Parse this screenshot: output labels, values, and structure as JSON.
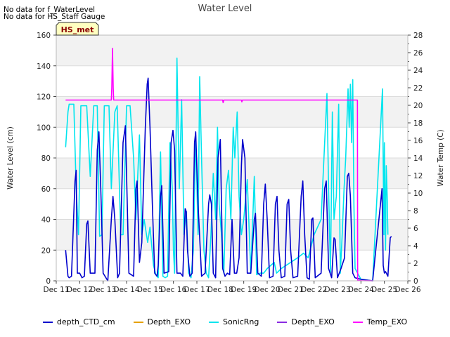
{
  "notes": [
    "No data for f_WaterLevel",
    "No data for HS_Staff Gauge"
  ],
  "site_badge": "HS_met",
  "chart_data": {
    "type": "line",
    "title": "Water Level",
    "xlabel": "",
    "ylabel": "Water Level (cm)",
    "y2label": "Water Temp (C)",
    "xlim": [
      11,
      26
    ],
    "ylim": [
      0,
      160
    ],
    "y2lim": [
      0,
      28
    ],
    "x_ticks": [
      {
        "v": 11,
        "label": "Dec 11"
      },
      {
        "v": 12,
        "label": "Dec 12"
      },
      {
        "v": 13,
        "label": "Dec 13"
      },
      {
        "v": 14,
        "label": "Dec 14"
      },
      {
        "v": 15,
        "label": "Dec 15"
      },
      {
        "v": 16,
        "label": "Dec 16"
      },
      {
        "v": 17,
        "label": "Dec 17"
      },
      {
        "v": 18,
        "label": "Dec 18"
      },
      {
        "v": 19,
        "label": "Dec 19"
      },
      {
        "v": 20,
        "label": "Dec 20"
      },
      {
        "v": 21,
        "label": "Dec 21"
      },
      {
        "v": 22,
        "label": "Dec 22"
      },
      {
        "v": 23,
        "label": "Dec 23"
      },
      {
        "v": 24,
        "label": "Dec 24"
      },
      {
        "v": 25,
        "label": "Dec 25"
      },
      {
        "v": 26,
        "label": "Dec 26"
      }
    ],
    "y_ticks": [
      0,
      20,
      40,
      60,
      80,
      100,
      120,
      140,
      160
    ],
    "y2_ticks": [
      0,
      2,
      4,
      6,
      8,
      10,
      12,
      14,
      16,
      18,
      20,
      22,
      24,
      26,
      28
    ],
    "legend_position": "bottom",
    "series": [
      {
        "name": "depth_CTD_cm",
        "color": "#0000cc",
        "axis": "left",
        "points": [
          [
            11.4,
            20
          ],
          [
            11.5,
            3
          ],
          [
            11.55,
            2
          ],
          [
            11.65,
            3
          ],
          [
            11.8,
            65
          ],
          [
            11.85,
            72
          ],
          [
            11.9,
            5
          ],
          [
            12.0,
            5
          ],
          [
            12.1,
            2
          ],
          [
            12.2,
            3
          ],
          [
            12.3,
            37
          ],
          [
            12.35,
            39
          ],
          [
            12.45,
            5
          ],
          [
            12.65,
            5
          ],
          [
            12.75,
            85
          ],
          [
            12.82,
            97
          ],
          [
            12.9,
            60
          ],
          [
            13.0,
            5
          ],
          [
            13.2,
            0
          ],
          [
            13.35,
            40
          ],
          [
            13.42,
            55
          ],
          [
            13.5,
            40
          ],
          [
            13.62,
            2
          ],
          [
            13.7,
            5
          ],
          [
            13.85,
            90
          ],
          [
            13.95,
            101
          ],
          [
            14.1,
            5
          ],
          [
            14.3,
            3
          ],
          [
            14.4,
            60
          ],
          [
            14.45,
            65
          ],
          [
            14.55,
            12
          ],
          [
            14.65,
            25
          ],
          [
            14.8,
            100
          ],
          [
            14.88,
            128
          ],
          [
            14.92,
            132
          ],
          [
            15.0,
            100
          ],
          [
            15.1,
            50
          ],
          [
            15.2,
            5
          ],
          [
            15.3,
            3
          ],
          [
            15.35,
            10
          ],
          [
            15.45,
            55
          ],
          [
            15.5,
            62
          ],
          [
            15.6,
            5
          ],
          [
            15.8,
            6
          ],
          [
            15.9,
            90
          ],
          [
            15.98,
            98
          ],
          [
            16.05,
            85
          ],
          [
            16.15,
            5
          ],
          [
            16.3,
            5
          ],
          [
            16.4,
            3
          ],
          [
            16.5,
            47
          ],
          [
            16.55,
            45
          ],
          [
            16.6,
            20
          ],
          [
            16.7,
            3
          ],
          [
            16.8,
            5
          ],
          [
            16.9,
            90
          ],
          [
            16.95,
            97
          ],
          [
            17.05,
            50
          ],
          [
            17.2,
            3
          ],
          [
            17.35,
            5
          ],
          [
            17.5,
            50
          ],
          [
            17.55,
            56
          ],
          [
            17.62,
            50
          ],
          [
            17.7,
            5
          ],
          [
            17.8,
            2
          ],
          [
            17.9,
            80
          ],
          [
            18.0,
            92
          ],
          [
            18.1,
            8
          ],
          [
            18.2,
            3
          ],
          [
            18.3,
            5
          ],
          [
            18.4,
            4
          ],
          [
            18.5,
            40
          ],
          [
            18.6,
            5
          ],
          [
            18.7,
            5
          ],
          [
            18.8,
            15
          ],
          [
            18.9,
            75
          ],
          [
            18.95,
            92
          ],
          [
            19.05,
            80
          ],
          [
            19.15,
            5
          ],
          [
            19.3,
            5
          ],
          [
            19.45,
            40
          ],
          [
            19.5,
            44
          ],
          [
            19.6,
            5
          ],
          [
            19.75,
            3
          ],
          [
            19.85,
            50
          ],
          [
            19.92,
            63
          ],
          [
            20.0,
            40
          ],
          [
            20.1,
            2
          ],
          [
            20.25,
            3
          ],
          [
            20.35,
            50
          ],
          [
            20.42,
            55
          ],
          [
            20.5,
            20
          ],
          [
            20.6,
            2
          ],
          [
            20.75,
            3
          ],
          [
            20.85,
            50
          ],
          [
            20.92,
            53
          ],
          [
            21.0,
            20
          ],
          [
            21.1,
            2
          ],
          [
            21.3,
            3
          ],
          [
            21.45,
            55
          ],
          [
            21.52,
            65
          ],
          [
            21.6,
            30
          ],
          [
            21.7,
            2
          ],
          [
            21.8,
            1
          ],
          [
            21.9,
            40
          ],
          [
            21.95,
            41
          ],
          [
            22.05,
            2
          ],
          [
            22.3,
            5
          ],
          [
            22.45,
            60
          ],
          [
            22.52,
            65
          ],
          [
            22.62,
            8
          ],
          [
            22.75,
            2
          ],
          [
            22.85,
            28
          ],
          [
            22.9,
            27
          ],
          [
            23.0,
            2
          ],
          [
            23.15,
            8
          ],
          [
            23.3,
            15
          ],
          [
            23.42,
            68
          ],
          [
            23.48,
            70
          ],
          [
            23.55,
            55
          ],
          [
            23.65,
            5
          ],
          [
            23.75,
            2
          ],
          [
            24.0,
            1
          ],
          [
            24.5,
            0
          ],
          [
            24.9,
            60
          ],
          [
            24.95,
            10
          ],
          [
            25.0,
            5
          ],
          [
            25.05,
            6
          ],
          [
            25.15,
            3
          ],
          [
            25.25,
            28
          ],
          [
            25.3,
            29
          ]
        ]
      },
      {
        "name": "Depth_EXO",
        "color": "#e6a100",
        "axis": "left",
        "points": []
      },
      {
        "name": "SonicRng",
        "color": "#00e5ee",
        "axis": "left",
        "points": [
          [
            11.4,
            87
          ],
          [
            11.5,
            110
          ],
          [
            11.55,
            115
          ],
          [
            11.75,
            115
          ],
          [
            11.85,
            60
          ],
          [
            11.95,
            30
          ],
          [
            12.05,
            114
          ],
          [
            12.3,
            114
          ],
          [
            12.45,
            68
          ],
          [
            12.6,
            114
          ],
          [
            12.75,
            114
          ],
          [
            12.85,
            29
          ],
          [
            12.95,
            30
          ],
          [
            13.05,
            114
          ],
          [
            13.25,
            114
          ],
          [
            13.35,
            60
          ],
          [
            13.5,
            110
          ],
          [
            13.6,
            114
          ],
          [
            13.75,
            30
          ],
          [
            13.85,
            30
          ],
          [
            14.0,
            114
          ],
          [
            14.15,
            114
          ],
          [
            14.3,
            80
          ],
          [
            14.4,
            40
          ],
          [
            14.55,
            95
          ],
          [
            14.65,
            30
          ],
          [
            14.75,
            40
          ],
          [
            14.9,
            25
          ],
          [
            15.0,
            35
          ],
          [
            15.15,
            10
          ],
          [
            15.25,
            4
          ],
          [
            15.35,
            2
          ],
          [
            15.45,
            84
          ],
          [
            15.55,
            3
          ],
          [
            15.65,
            2
          ],
          [
            15.75,
            3
          ],
          [
            15.85,
            90
          ],
          [
            15.95,
            60
          ],
          [
            16.0,
            20
          ],
          [
            16.05,
            5
          ],
          [
            16.15,
            145
          ],
          [
            16.2,
            100
          ],
          [
            16.25,
            60
          ],
          [
            16.35,
            118
          ],
          [
            16.45,
            30
          ],
          [
            16.55,
            45
          ],
          [
            16.65,
            5
          ],
          [
            16.75,
            2
          ],
          [
            16.85,
            20
          ],
          [
            16.95,
            95
          ],
          [
            17.05,
            30
          ],
          [
            17.12,
            133
          ],
          [
            17.2,
            80
          ],
          [
            17.3,
            20
          ],
          [
            17.4,
            5
          ],
          [
            17.5,
            2
          ],
          [
            17.6,
            30
          ],
          [
            17.7,
            70
          ],
          [
            17.8,
            40
          ],
          [
            17.88,
            100
          ],
          [
            17.95,
            50
          ],
          [
            18.05,
            30
          ],
          [
            18.15,
            5
          ],
          [
            18.25,
            60
          ],
          [
            18.35,
            72
          ],
          [
            18.45,
            40
          ],
          [
            18.55,
            100
          ],
          [
            18.62,
            80
          ],
          [
            18.72,
            110
          ],
          [
            18.8,
            55
          ],
          [
            18.9,
            30
          ],
          [
            19.0,
            40
          ],
          [
            19.15,
            66
          ],
          [
            19.3,
            5
          ],
          [
            19.45,
            68
          ],
          [
            19.55,
            4
          ],
          [
            19.7,
            5
          ],
          [
            19.85,
            5
          ],
          [
            20.0,
            8
          ],
          [
            20.3,
            12
          ],
          [
            20.4,
            5
          ],
          [
            20.6,
            8
          ],
          [
            20.9,
            11
          ],
          [
            21.3,
            15
          ],
          [
            21.55,
            18
          ],
          [
            21.75,
            15
          ],
          [
            22.0,
            30
          ],
          [
            22.3,
            40
          ],
          [
            22.55,
            122
          ],
          [
            22.62,
            60
          ],
          [
            22.7,
            5
          ],
          [
            22.78,
            110
          ],
          [
            22.85,
            40
          ],
          [
            22.95,
            55
          ],
          [
            23.05,
            115
          ],
          [
            23.12,
            5
          ],
          [
            23.2,
            30
          ],
          [
            23.28,
            60
          ],
          [
            23.35,
            80
          ],
          [
            23.45,
            125
          ],
          [
            23.5,
            100
          ],
          [
            23.55,
            128
          ],
          [
            23.6,
            90
          ],
          [
            23.65,
            131
          ],
          [
            23.7,
            50
          ],
          [
            23.75,
            8
          ],
          [
            24.0,
            1
          ],
          [
            24.5,
            0
          ],
          [
            24.92,
            125
          ],
          [
            24.98,
            30
          ],
          [
            25.0,
            90
          ],
          [
            25.05,
            20
          ],
          [
            25.08,
            75
          ],
          [
            25.12,
            55
          ],
          [
            25.15,
            30
          ]
        ]
      },
      {
        "name": "Depth_EXO",
        "color": "#8a2be2",
        "axis": "left",
        "points": []
      },
      {
        "name": "Temp_EXO",
        "color": "#ff00ff",
        "axis": "right",
        "points": [
          [
            11.4,
            20.6
          ],
          [
            13.35,
            20.6
          ],
          [
            13.37,
            22.0
          ],
          [
            13.4,
            26.5
          ],
          [
            13.43,
            22.0
          ],
          [
            13.45,
            20.6
          ],
          [
            18.1,
            20.6
          ],
          [
            18.12,
            20.3
          ],
          [
            18.15,
            20.6
          ],
          [
            18.9,
            20.6
          ],
          [
            18.92,
            20.4
          ],
          [
            18.94,
            20.6
          ],
          [
            23.85,
            20.6
          ],
          [
            23.86,
            0.05
          ],
          [
            24.0,
            0.02
          ],
          [
            24.5,
            0.0
          ]
        ]
      }
    ]
  }
}
